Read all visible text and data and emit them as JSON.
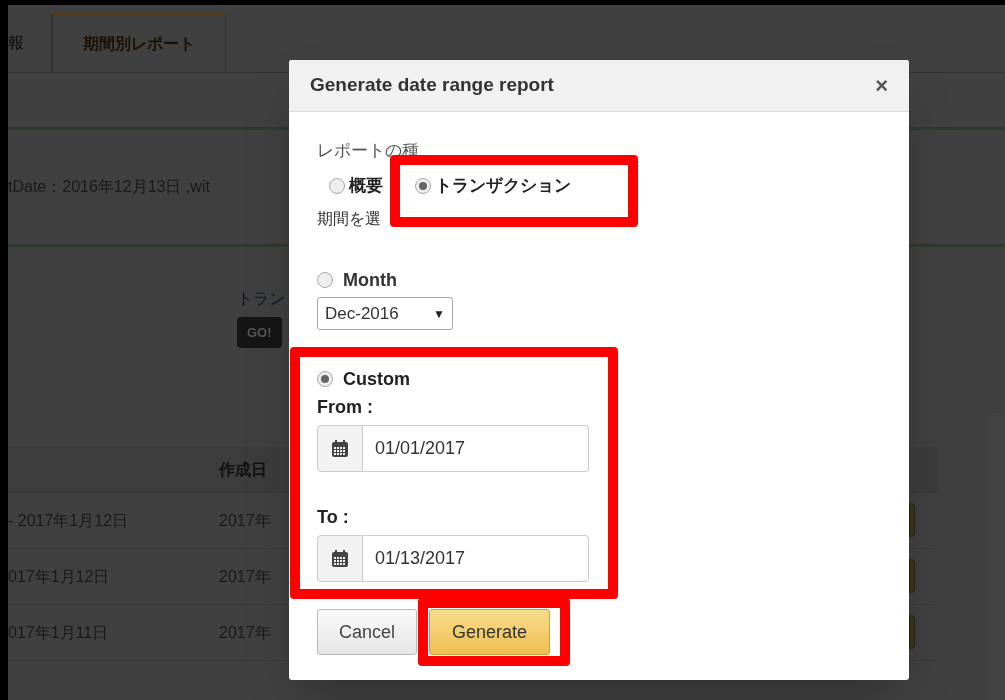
{
  "background": {
    "tabs": [
      {
        "label": "報",
        "selected": false
      },
      {
        "label": "期間別レポート",
        "selected": true
      }
    ],
    "info_text": "tDate：2016年12月13日 ,wit",
    "link": "トラン",
    "go_button": "GO!",
    "table": {
      "columns": [
        "",
        "作成日"
      ],
      "rows": [
        [
          "- 2017年1月12日",
          "2017年"
        ],
        [
          "017年1月12日",
          "2017年"
        ],
        [
          "017年1月11日",
          "2017年"
        ]
      ]
    }
  },
  "dialog": {
    "title": "Generate date range report",
    "close": "×",
    "report_type_label": "レポートの種",
    "report_types": [
      {
        "label": "概要",
        "selected": false
      },
      {
        "label": "トランザクション",
        "selected": true
      }
    ],
    "period_label": "期間を選",
    "period_options": [
      {
        "kind": "month",
        "label": "Month",
        "selected": false,
        "value": "Dec-2016",
        "caret": "▼"
      },
      {
        "kind": "custom",
        "label": "Custom",
        "selected": true,
        "from_label": "From :",
        "from_value": "01/01/2017",
        "to_label": "To :",
        "to_value": "01/13/2017"
      }
    ],
    "buttons": [
      {
        "label": "Cancel",
        "kind": "default"
      },
      {
        "label": "Generate",
        "kind": "primary"
      }
    ]
  }
}
